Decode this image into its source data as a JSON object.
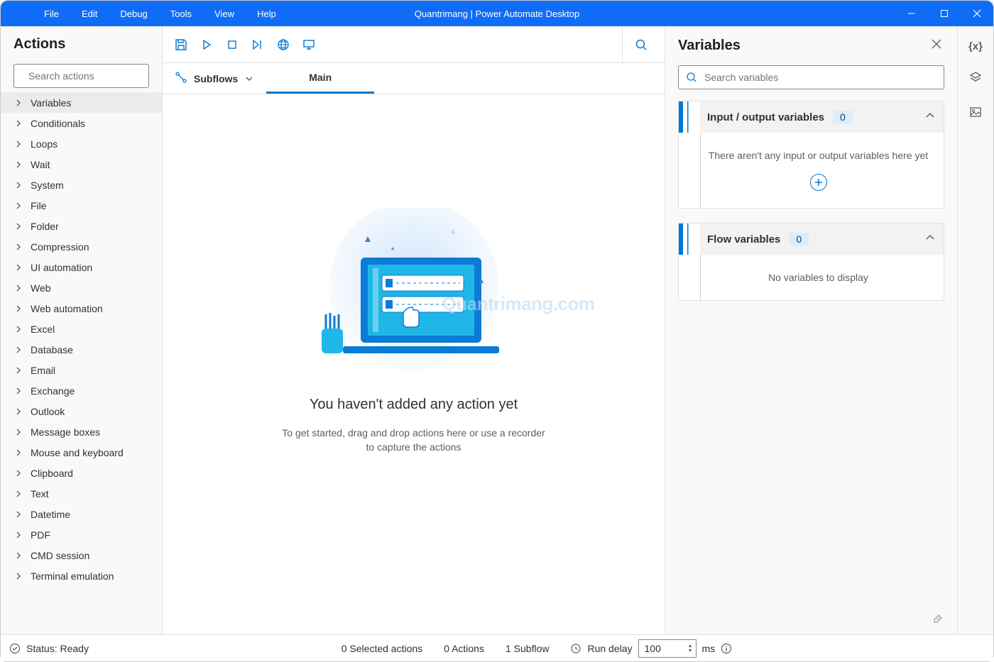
{
  "title": "Quantrimang | Power Automate Desktop",
  "menu": [
    "File",
    "Edit",
    "Debug",
    "Tools",
    "View",
    "Help"
  ],
  "actions_panel": {
    "title": "Actions",
    "search_placeholder": "Search actions",
    "items": [
      "Variables",
      "Conditionals",
      "Loops",
      "Wait",
      "System",
      "File",
      "Folder",
      "Compression",
      "UI automation",
      "Web",
      "Web automation",
      "Excel",
      "Database",
      "Email",
      "Exchange",
      "Outlook",
      "Message boxes",
      "Mouse and keyboard",
      "Clipboard",
      "Text",
      "Datetime",
      "PDF",
      "CMD session",
      "Terminal emulation"
    ],
    "selected": 0
  },
  "center": {
    "subflows_label": "Subflows",
    "tab_main": "Main",
    "empty_title": "You haven't added any action yet",
    "empty_subtitle": "To get started, drag and drop actions here or use a recorder to capture the actions"
  },
  "variables_panel": {
    "title": "Variables",
    "search_placeholder": "Search variables",
    "io_title": "Input / output variables",
    "io_count": "0",
    "io_empty": "There aren't any input or output variables here yet",
    "flow_title": "Flow variables",
    "flow_count": "0",
    "flow_empty": "No variables to display"
  },
  "statusbar": {
    "status": "Status: Ready",
    "selected": "0 Selected actions",
    "actions": "0 Actions",
    "subflow": "1 Subflow",
    "run_delay_label": "Run delay",
    "run_delay_value": "100",
    "ms": "ms"
  },
  "watermark": "Quantrimang.com"
}
